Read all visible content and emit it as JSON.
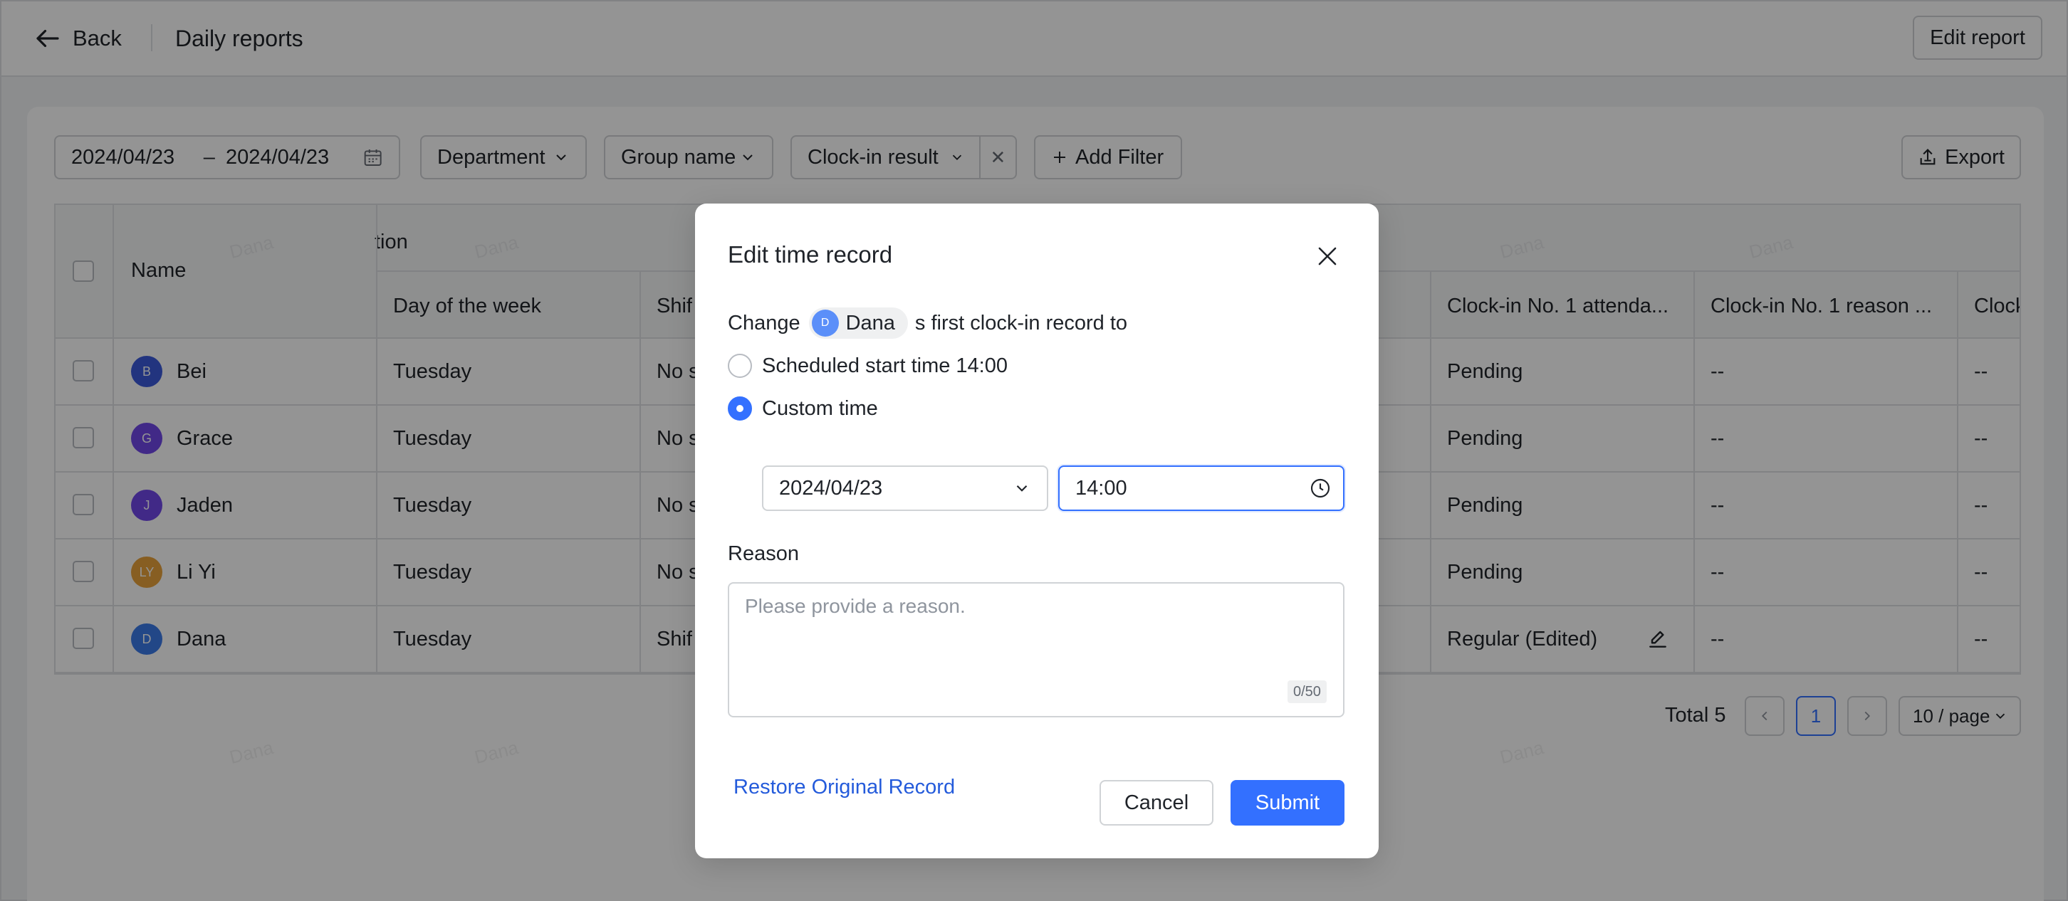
{
  "header": {
    "back_label": "Back",
    "title": "Daily reports",
    "edit_report_label": "Edit report"
  },
  "filters": {
    "date_start": "2024/04/23",
    "date_sep": "–",
    "date_end": "2024/04/23",
    "department": "Department",
    "group_name": "Group name",
    "clock_in_result": "Clock-in result",
    "add_filter": "Add Filter",
    "export": "Export"
  },
  "table": {
    "group_header_partial": "tion",
    "columns": {
      "name": "Name",
      "day": "Day of the week",
      "shift": "Shif",
      "attendance": "Clock-in No. 1 attenda...",
      "reason": "Clock-in No. 1 reason ...",
      "next": "Clock"
    },
    "rows": [
      {
        "initial": "B",
        "name": "Bei",
        "color": "#3b5bdb",
        "day": "Tuesday",
        "shift": "No s",
        "attendance": "Pending",
        "reason": "--",
        "next": "--"
      },
      {
        "initial": "G",
        "name": "Grace",
        "color": "#7048e8",
        "day": "Tuesday",
        "shift": "No s",
        "attendance": "Pending",
        "reason": "--",
        "next": "--"
      },
      {
        "initial": "J",
        "name": "Jaden",
        "color": "#7048e8",
        "day": "Tuesday",
        "shift": "No s",
        "attendance": "Pending",
        "reason": "--",
        "next": "--"
      },
      {
        "initial": "LY",
        "name": "Li Yi",
        "color": "#e8a33c",
        "day": "Tuesday",
        "shift": "No s",
        "attendance": "Pending",
        "reason": "--",
        "next": "--"
      },
      {
        "initial": "D",
        "name": "Dana",
        "color": "#3b7ae8",
        "day": "Tuesday",
        "shift": "Shif",
        "attendance": "Regular (Edited)",
        "reason": "--",
        "next": "--"
      }
    ]
  },
  "pagination": {
    "total": "Total 5",
    "current_page": "1",
    "page_size": "10 / page"
  },
  "watermark": "Dana",
  "modal": {
    "title": "Edit time record",
    "change_prefix": "Change",
    "user_initial": "D",
    "user_name": "Dana",
    "change_suffix": "s first clock-in record to",
    "option_scheduled": "Scheduled start time 14:00",
    "option_custom": "Custom time",
    "selected_option": "Custom time",
    "date_value": "2024/04/23",
    "time_value": "14:00",
    "reason_label": "Reason",
    "reason_placeholder": "Please provide a reason.",
    "reason_counter": "0/50",
    "restore_label": "Restore Original Record",
    "cancel_label": "Cancel",
    "submit_label": "Submit"
  },
  "colors": {
    "accent": "#3370ff",
    "link": "#245bdb",
    "overlay": "rgba(0,0,0,0.42)"
  }
}
